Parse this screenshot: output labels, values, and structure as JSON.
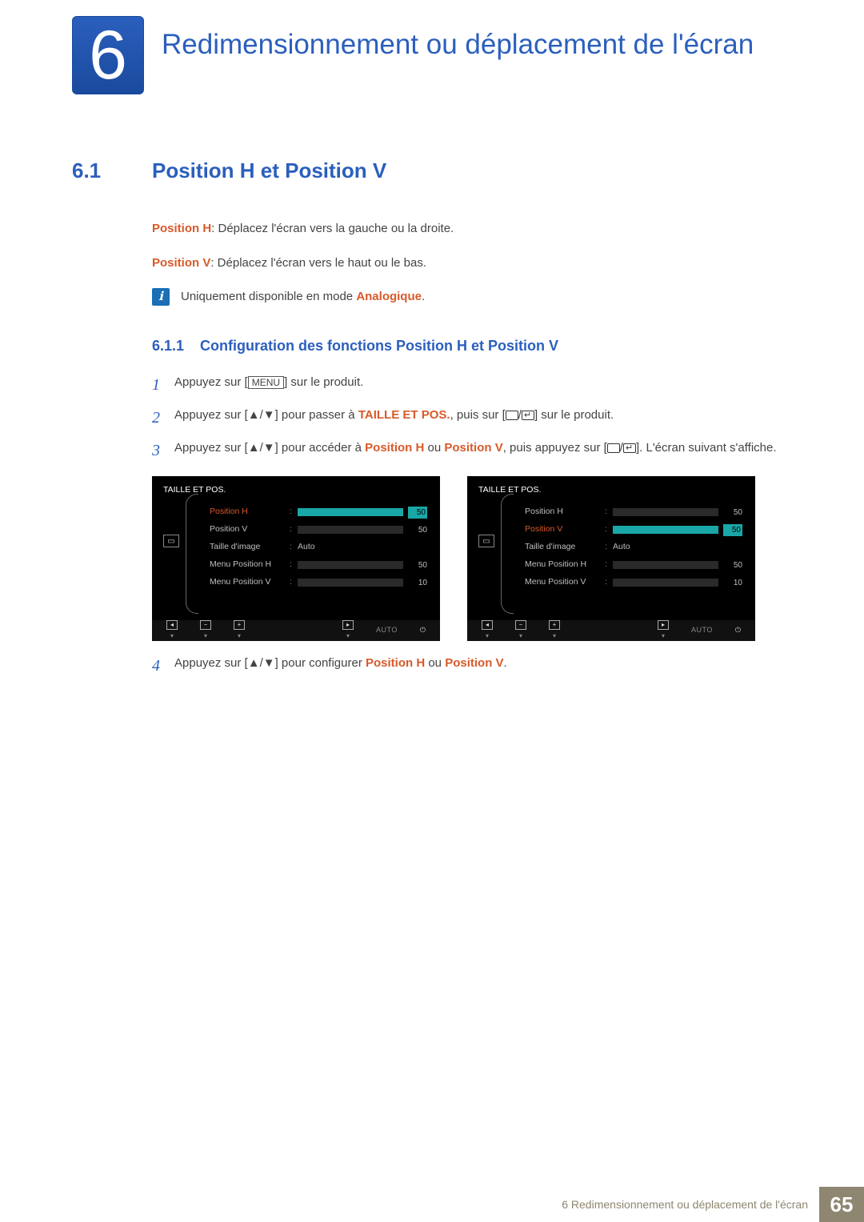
{
  "chapter": {
    "number": "6",
    "title": "Redimensionnement ou déplacement de l'écran"
  },
  "section": {
    "number": "6.1",
    "title": "Position H et Position V"
  },
  "defs": {
    "posH_label": "Position H",
    "posH_text": ": Déplacez l'écran vers la gauche ou la droite.",
    "posV_label": "Position V",
    "posV_text": ": Déplacez l'écran vers le haut ou le bas."
  },
  "note": {
    "prefix": "Uniquement disponible en mode ",
    "mode": "Analogique",
    "suffix": "."
  },
  "subsection": {
    "number": "6.1.1",
    "title": "Configuration des fonctions Position H et Position V"
  },
  "steps": {
    "s1": {
      "num": "1",
      "a": "Appuyez sur [",
      "menu": "MENU",
      "b": "] sur le produit."
    },
    "s2": {
      "num": "2",
      "a": "Appuyez sur [",
      "updown": "▲/▼",
      "b": "] pour passer à ",
      "target": "TAILLE ET POS.",
      "c": ", puis sur [",
      "d": "] sur le produit."
    },
    "s3": {
      "num": "3",
      "a": "Appuyez sur [",
      "updown": "▲/▼",
      "b": "] pour accéder à ",
      "t1": "Position H",
      "mid": " ou ",
      "t2": "Position V",
      "c": ", puis appuyez sur [",
      "d": "]. L'écran suivant s'affiche."
    },
    "s4": {
      "num": "4",
      "a": "Appuyez sur [",
      "updown": "▲/▼",
      "b": "] pour configurer ",
      "t1": "Position H",
      "mid": " ou ",
      "t2": "Position V",
      "suffix": "."
    }
  },
  "osd": {
    "title": "TAILLE ET POS.",
    "items": {
      "posH": "Position H",
      "posV": "Position V",
      "imgSize": "Taille d'image",
      "menuH": "Menu Position H",
      "menuV": "Menu Position V"
    },
    "values": {
      "posH": "50",
      "posV": "50",
      "imgSize": "Auto",
      "menuH": "50",
      "menuV": "10"
    },
    "footer": {
      "auto": "AUTO"
    }
  },
  "footer": {
    "text": "6 Redimensionnement ou déplacement de l'écran",
    "page": "65"
  }
}
